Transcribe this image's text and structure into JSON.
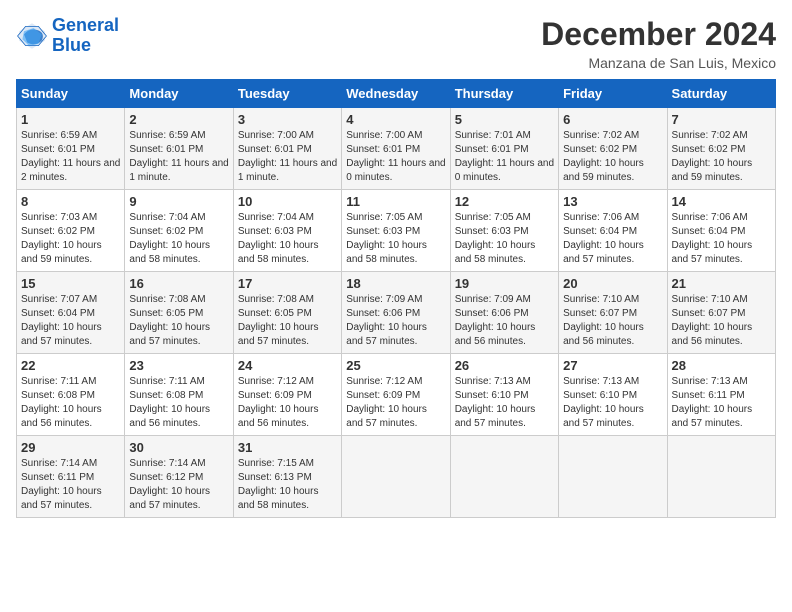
{
  "header": {
    "logo_line1": "General",
    "logo_line2": "Blue",
    "month": "December 2024",
    "location": "Manzana de San Luis, Mexico"
  },
  "weekdays": [
    "Sunday",
    "Monday",
    "Tuesday",
    "Wednesday",
    "Thursday",
    "Friday",
    "Saturday"
  ],
  "weeks": [
    [
      {
        "day": "1",
        "sunrise": "Sunrise: 6:59 AM",
        "sunset": "Sunset: 6:01 PM",
        "daylight": "Daylight: 11 hours and 2 minutes."
      },
      {
        "day": "2",
        "sunrise": "Sunrise: 6:59 AM",
        "sunset": "Sunset: 6:01 PM",
        "daylight": "Daylight: 11 hours and 1 minute."
      },
      {
        "day": "3",
        "sunrise": "Sunrise: 7:00 AM",
        "sunset": "Sunset: 6:01 PM",
        "daylight": "Daylight: 11 hours and 1 minute."
      },
      {
        "day": "4",
        "sunrise": "Sunrise: 7:00 AM",
        "sunset": "Sunset: 6:01 PM",
        "daylight": "Daylight: 11 hours and 0 minutes."
      },
      {
        "day": "5",
        "sunrise": "Sunrise: 7:01 AM",
        "sunset": "Sunset: 6:01 PM",
        "daylight": "Daylight: 11 hours and 0 minutes."
      },
      {
        "day": "6",
        "sunrise": "Sunrise: 7:02 AM",
        "sunset": "Sunset: 6:02 PM",
        "daylight": "Daylight: 10 hours and 59 minutes."
      },
      {
        "day": "7",
        "sunrise": "Sunrise: 7:02 AM",
        "sunset": "Sunset: 6:02 PM",
        "daylight": "Daylight: 10 hours and 59 minutes."
      }
    ],
    [
      {
        "day": "8",
        "sunrise": "Sunrise: 7:03 AM",
        "sunset": "Sunset: 6:02 PM",
        "daylight": "Daylight: 10 hours and 59 minutes."
      },
      {
        "day": "9",
        "sunrise": "Sunrise: 7:04 AM",
        "sunset": "Sunset: 6:02 PM",
        "daylight": "Daylight: 10 hours and 58 minutes."
      },
      {
        "day": "10",
        "sunrise": "Sunrise: 7:04 AM",
        "sunset": "Sunset: 6:03 PM",
        "daylight": "Daylight: 10 hours and 58 minutes."
      },
      {
        "day": "11",
        "sunrise": "Sunrise: 7:05 AM",
        "sunset": "Sunset: 6:03 PM",
        "daylight": "Daylight: 10 hours and 58 minutes."
      },
      {
        "day": "12",
        "sunrise": "Sunrise: 7:05 AM",
        "sunset": "Sunset: 6:03 PM",
        "daylight": "Daylight: 10 hours and 58 minutes."
      },
      {
        "day": "13",
        "sunrise": "Sunrise: 7:06 AM",
        "sunset": "Sunset: 6:04 PM",
        "daylight": "Daylight: 10 hours and 57 minutes."
      },
      {
        "day": "14",
        "sunrise": "Sunrise: 7:06 AM",
        "sunset": "Sunset: 6:04 PM",
        "daylight": "Daylight: 10 hours and 57 minutes."
      }
    ],
    [
      {
        "day": "15",
        "sunrise": "Sunrise: 7:07 AM",
        "sunset": "Sunset: 6:04 PM",
        "daylight": "Daylight: 10 hours and 57 minutes."
      },
      {
        "day": "16",
        "sunrise": "Sunrise: 7:08 AM",
        "sunset": "Sunset: 6:05 PM",
        "daylight": "Daylight: 10 hours and 57 minutes."
      },
      {
        "day": "17",
        "sunrise": "Sunrise: 7:08 AM",
        "sunset": "Sunset: 6:05 PM",
        "daylight": "Daylight: 10 hours and 57 minutes."
      },
      {
        "day": "18",
        "sunrise": "Sunrise: 7:09 AM",
        "sunset": "Sunset: 6:06 PM",
        "daylight": "Daylight: 10 hours and 57 minutes."
      },
      {
        "day": "19",
        "sunrise": "Sunrise: 7:09 AM",
        "sunset": "Sunset: 6:06 PM",
        "daylight": "Daylight: 10 hours and 56 minutes."
      },
      {
        "day": "20",
        "sunrise": "Sunrise: 7:10 AM",
        "sunset": "Sunset: 6:07 PM",
        "daylight": "Daylight: 10 hours and 56 minutes."
      },
      {
        "day": "21",
        "sunrise": "Sunrise: 7:10 AM",
        "sunset": "Sunset: 6:07 PM",
        "daylight": "Daylight: 10 hours and 56 minutes."
      }
    ],
    [
      {
        "day": "22",
        "sunrise": "Sunrise: 7:11 AM",
        "sunset": "Sunset: 6:08 PM",
        "daylight": "Daylight: 10 hours and 56 minutes."
      },
      {
        "day": "23",
        "sunrise": "Sunrise: 7:11 AM",
        "sunset": "Sunset: 6:08 PM",
        "daylight": "Daylight: 10 hours and 56 minutes."
      },
      {
        "day": "24",
        "sunrise": "Sunrise: 7:12 AM",
        "sunset": "Sunset: 6:09 PM",
        "daylight": "Daylight: 10 hours and 56 minutes."
      },
      {
        "day": "25",
        "sunrise": "Sunrise: 7:12 AM",
        "sunset": "Sunset: 6:09 PM",
        "daylight": "Daylight: 10 hours and 57 minutes."
      },
      {
        "day": "26",
        "sunrise": "Sunrise: 7:13 AM",
        "sunset": "Sunset: 6:10 PM",
        "daylight": "Daylight: 10 hours and 57 minutes."
      },
      {
        "day": "27",
        "sunrise": "Sunrise: 7:13 AM",
        "sunset": "Sunset: 6:10 PM",
        "daylight": "Daylight: 10 hours and 57 minutes."
      },
      {
        "day": "28",
        "sunrise": "Sunrise: 7:13 AM",
        "sunset": "Sunset: 6:11 PM",
        "daylight": "Daylight: 10 hours and 57 minutes."
      }
    ],
    [
      {
        "day": "29",
        "sunrise": "Sunrise: 7:14 AM",
        "sunset": "Sunset: 6:11 PM",
        "daylight": "Daylight: 10 hours and 57 minutes."
      },
      {
        "day": "30",
        "sunrise": "Sunrise: 7:14 AM",
        "sunset": "Sunset: 6:12 PM",
        "daylight": "Daylight: 10 hours and 57 minutes."
      },
      {
        "day": "31",
        "sunrise": "Sunrise: 7:15 AM",
        "sunset": "Sunset: 6:13 PM",
        "daylight": "Daylight: 10 hours and 58 minutes."
      },
      null,
      null,
      null,
      null
    ]
  ]
}
